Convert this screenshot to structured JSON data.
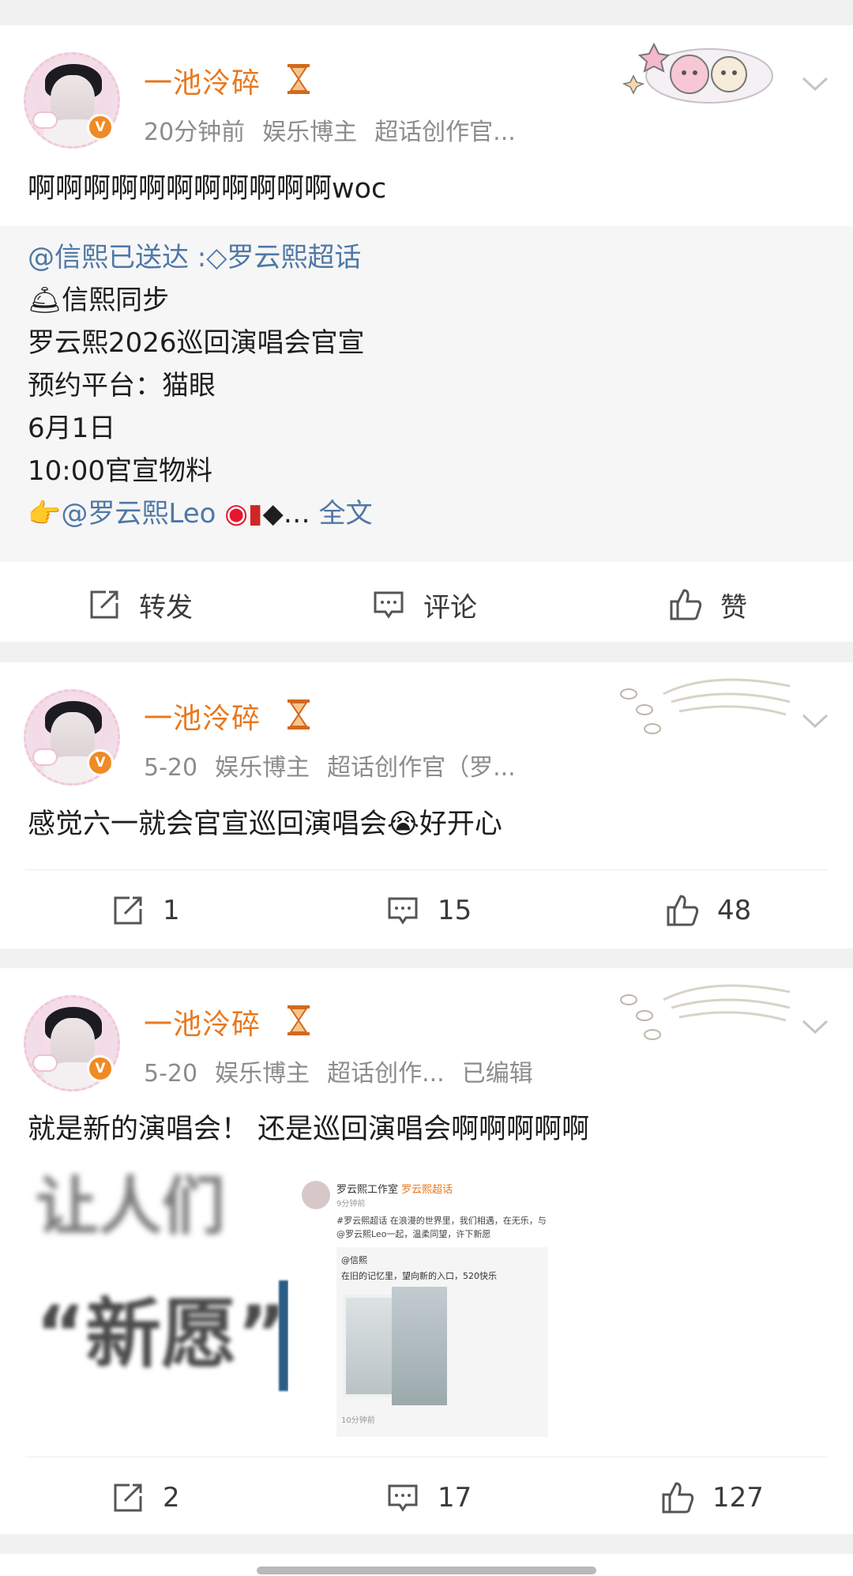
{
  "posts": [
    {
      "author": "一池泠碎",
      "time": "20分钟前",
      "tags": [
        "娱乐博主",
        "超话创作官..."
      ],
      "text": "啊啊啊啊啊啊啊啊啊啊啊woc",
      "repost": {
        "mention": "@信熙已送达",
        "separator": " :",
        "topic": "罗云熙超话",
        "line2": "信熙同步",
        "line3": "罗云熙2026巡回演唱会官宣",
        "line4": "预约平台：猫眼",
        "line5": "6月1日",
        "line6": "10:00官宣物料",
        "line7_mention": "@罗云熙Leo",
        "line7_ellipsis": "…",
        "fulltext": "全文"
      },
      "actions": {
        "repost": "转发",
        "comment": "评论",
        "like": "赞"
      }
    },
    {
      "author": "一池泠碎",
      "time": "5-20",
      "tags": [
        "娱乐博主",
        "超话创作官（罗..."
      ],
      "text_before": "感觉六一就会官宣巡回演唱会",
      "text_after": "好开心",
      "actions": {
        "repost": "1",
        "comment": "15",
        "like": "48"
      }
    },
    {
      "author": "一池泠碎",
      "time": "5-20",
      "tags": [
        "娱乐博主",
        "超话创作...",
        "已编辑"
      ],
      "text": "就是新的演唱会！  还是巡回演唱会啊啊啊啊啊",
      "thumb_left_big": "“新愿”",
      "thumb_left_top": "让人们",
      "thumb_right": {
        "name": "罗云熙工作室",
        "topic": "罗云熙超话",
        "time": "9分钟前",
        "body": "#罗云熙超话 在浪漫的世界里，我们相遇，在无乐，与@罗云熙Leo一起，温柔同望，许下新愿",
        "inner_name": "@信熙",
        "inner_text": "在旧的记忆里，望向新的入口，520快乐",
        "inner_time": "10分钟前"
      },
      "actions": {
        "repost": "2",
        "comment": "17",
        "like": "127"
      }
    }
  ],
  "colors": {
    "username": "#e8781e",
    "link": "#4f78a6",
    "meta": "#8c8c8c",
    "vbadge": "#f08a24"
  }
}
